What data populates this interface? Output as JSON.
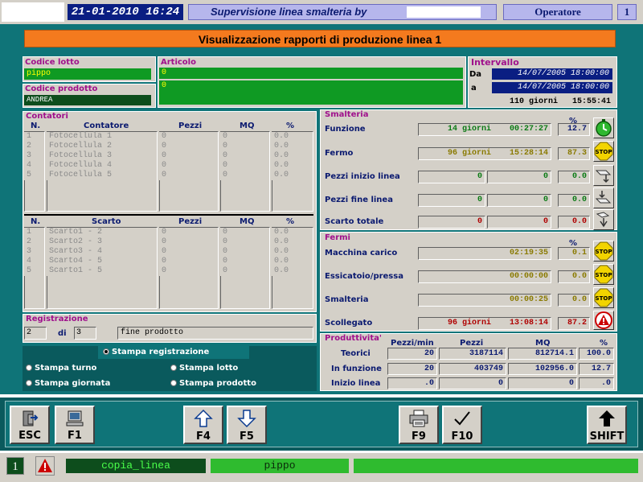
{
  "header": {
    "datetime": "21-01-2010 16:24",
    "title": "Supervisione linea smalteria by",
    "user_label": "Operatore",
    "station": "1"
  },
  "banner": {
    "title": "Visualizzazione rapporti di produzione linea 1"
  },
  "lotto": {
    "label": "Codice lotto",
    "value": "pippo"
  },
  "prodotto": {
    "label": "Codice prodotto",
    "value": "ANDREA"
  },
  "articolo": {
    "label": "Articolo",
    "line1": "0",
    "line2": "0"
  },
  "intervallo": {
    "label": "Intervallo",
    "da_label": "Da",
    "da": "14/07/2005 18:00:00",
    "a_label": "a",
    "a": "14/07/2005 18:00:00",
    "days": "110 giorni",
    "time": "15:55:41"
  },
  "contatori": {
    "label": "Contatori",
    "headers": {
      "n": "N.",
      "name": "Contatore",
      "pezzi": "Pezzi",
      "mq": "MQ",
      "pct": "%"
    },
    "rows": [
      {
        "n": "1",
        "name": "Fotocellula 1",
        "pezzi": "0",
        "mq": "0",
        "pct": "0.0"
      },
      {
        "n": "2",
        "name": "Fotocellula 2",
        "pezzi": "0",
        "mq": "0",
        "pct": "0.0"
      },
      {
        "n": "3",
        "name": "Fotocellula 3",
        "pezzi": "0",
        "mq": "0",
        "pct": "0.0"
      },
      {
        "n": "4",
        "name": "Fotocellula 4",
        "pezzi": "0",
        "mq": "0",
        "pct": "0.0"
      },
      {
        "n": "5",
        "name": "Fotocellula 5",
        "pezzi": "0",
        "mq": "0",
        "pct": "0.0"
      }
    ]
  },
  "scarti": {
    "headers": {
      "n": "N.",
      "name": "Scarto",
      "pezzi": "Pezzi",
      "mq": "MQ",
      "pct": "%"
    },
    "rows": [
      {
        "n": "1",
        "name": "Scarto1 - 2",
        "pezzi": "0",
        "mq": "0",
        "pct": "0.0"
      },
      {
        "n": "2",
        "name": "Scarto2 - 3",
        "pezzi": "0",
        "mq": "0",
        "pct": "0.0"
      },
      {
        "n": "3",
        "name": "Scarto3 - 4",
        "pezzi": "0",
        "mq": "0",
        "pct": "0.0"
      },
      {
        "n": "4",
        "name": "Scarto4 - 5",
        "pezzi": "0",
        "mq": "0",
        "pct": "0.0"
      },
      {
        "n": "5",
        "name": "Scarto1 - 5",
        "pezzi": "0",
        "mq": "0",
        "pct": "0.0"
      }
    ]
  },
  "registrazione": {
    "label": "Registrazione",
    "current": "2",
    "of": "di",
    "total": "3",
    "status": "fine prodotto"
  },
  "stampa": {
    "registrazione": "Stampa registrazione",
    "turno": "Stampa turno",
    "lotto": "Stampa lotto",
    "giornata": "Stampa giornata",
    "prodotto": "Stampa prodotto"
  },
  "smalteria": {
    "label": "Smalteria",
    "pct_header": "%",
    "funzione": {
      "label": "Funzione",
      "days": "14 giorni",
      "time": "00:27:27",
      "pct": "12.7"
    },
    "fermo": {
      "label": "Fermo",
      "days": "96 giorni",
      "time": "15:28:14",
      "pct": "87.3"
    },
    "inizio": {
      "label": "Pezzi inizio linea",
      "a": "0",
      "b": "0",
      "pct": "0.0"
    },
    "fine": {
      "label": "Pezzi fine linea",
      "a": "0",
      "b": "0",
      "pct": "0.0"
    },
    "scarto": {
      "label": "Scarto totale",
      "a": "0",
      "b": "0",
      "pct": "0.0"
    }
  },
  "fermi": {
    "label": "Fermi",
    "pct_header": "%",
    "carico": {
      "label": "Macchina carico",
      "time": "02:19:35",
      "pct": "0.1"
    },
    "essicatoio": {
      "label": "Essicatoio/pressa",
      "time": "00:00:00",
      "pct": "0.0"
    },
    "smalteria": {
      "label": "Smalteria",
      "time": "00:00:25",
      "pct": "0.0"
    },
    "scollegato": {
      "label": "Scollegato",
      "days": "96 giorni",
      "time": "13:08:14",
      "pct": "87.2"
    }
  },
  "produttivita": {
    "label": "Produttivita'",
    "headers": {
      "pezzimin": "Pezzi/min",
      "pezzi": "Pezzi",
      "mq": "MQ",
      "pct": "%"
    },
    "teorici": {
      "label": "Teorici",
      "pezzimin": "20",
      "pezzi": "3187114",
      "mq": "812714.1",
      "pct": "100.0"
    },
    "funzione": {
      "label": "In funzione",
      "pezzimin": "20",
      "pezzi": "403749",
      "mq": "102956.0",
      "pct": "12.7"
    },
    "inizio": {
      "label": "Inizio linea",
      "pezzimin": ".0",
      "pezzi": "0",
      "mq": "0",
      "pct": ".0"
    }
  },
  "fkeys": {
    "esc": "ESC",
    "f1": "F1",
    "f4": "F4",
    "f5": "F5",
    "f9": "F9",
    "f10": "F10",
    "shift": "SHIFT"
  },
  "statusbar": {
    "num": "1",
    "program": "copia_linea",
    "lot": "pippo"
  },
  "colors": {
    "teal": "#0f7478",
    "green": "#0f9a23",
    "banner": "#f47a1e",
    "title_blue": "#0b1a70"
  },
  "stop_icon_text": "STOP"
}
